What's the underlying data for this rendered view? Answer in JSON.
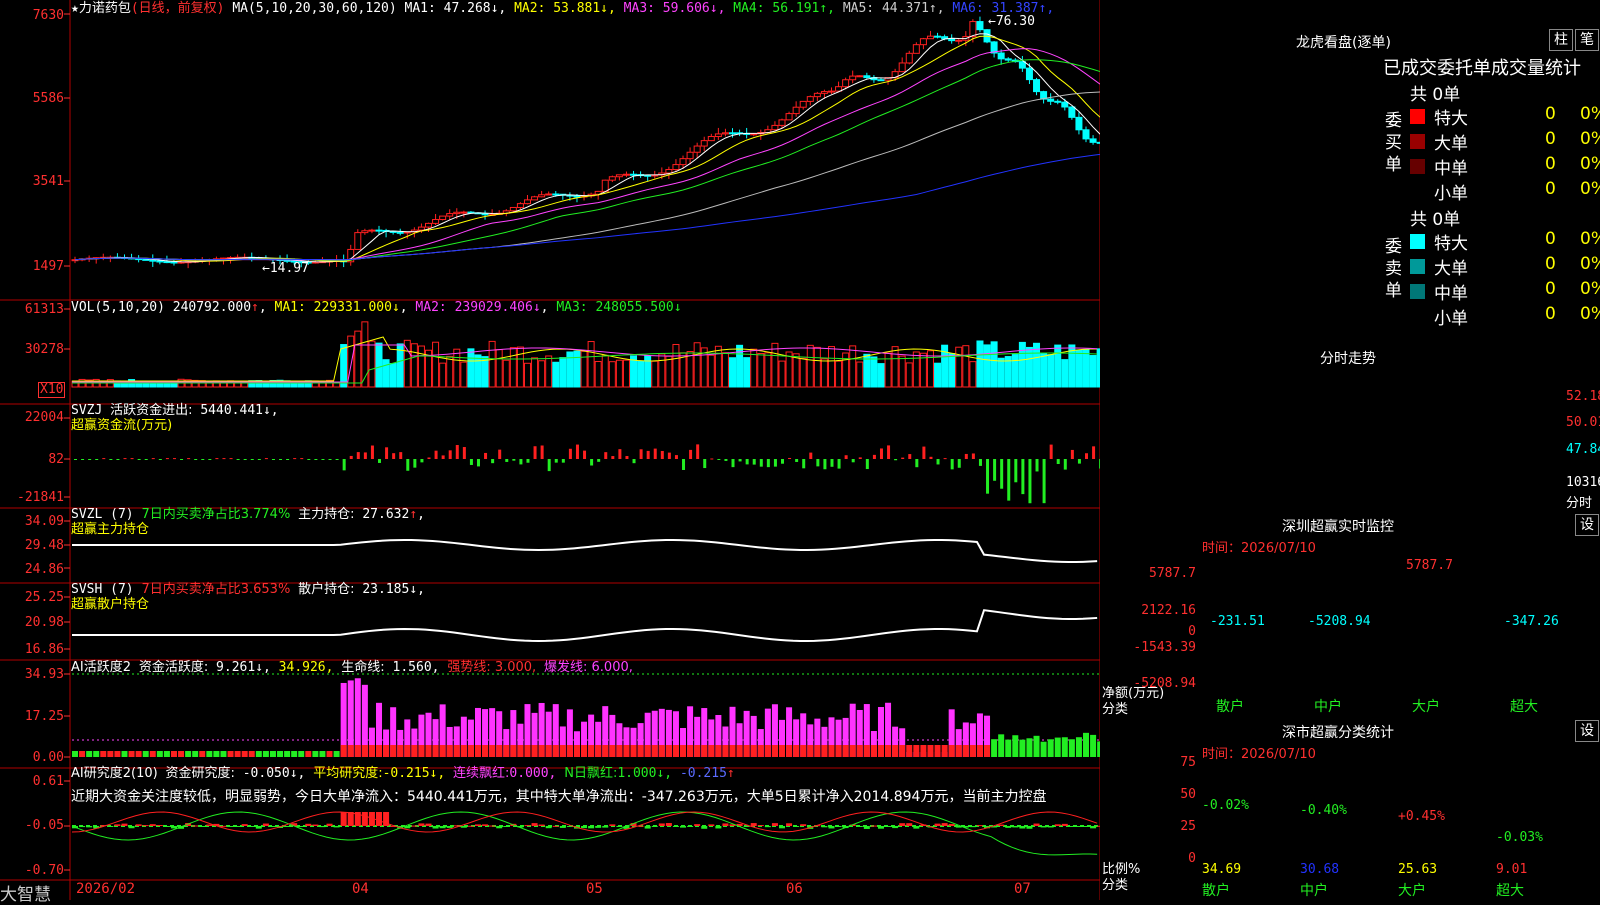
{
  "stock": {
    "name": "★力诺药包",
    "mode": "(日线，前复权)",
    "ma_title": "MA(5,10,20,30,60,120)",
    "ma": [
      {
        "label": "MA1:",
        "value": "47.268",
        "arrow": "↓",
        "color": "#ffffff"
      },
      {
        "label": "MA2:",
        "value": "53.881",
        "arrow": "↓",
        "color": "#ffff00"
      },
      {
        "label": "MA3:",
        "value": "59.606",
        "arrow": "↓",
        "color": "#ff44ff"
      },
      {
        "label": "MA4:",
        "value": "56.191",
        "arrow": "↑",
        "color": "#22ee22"
      },
      {
        "label": "MA5:",
        "value": "44.371",
        "arrow": "↑",
        "color": "#cccccc"
      },
      {
        "label": "MA6:",
        "value": "31.387",
        "arrow": "↑",
        "color": "#3344ff"
      }
    ],
    "price_axis": [
      "7630",
      "5586",
      "3541",
      "1497"
    ],
    "high_label": "76.30",
    "low_label": "14.97",
    "colors": {
      "up": "#ff2020",
      "down": "#00ffff",
      "ma1": "#ffffff",
      "ma2": "#ffff00",
      "ma3": "#ff44ff",
      "ma4": "#22ee22",
      "ma5": "#bbbbbb",
      "ma6": "#2233ff"
    }
  },
  "vol": {
    "title": "VOL(5,10,20)",
    "value": "240792.000",
    "ma1": "229331.000",
    "ma2": "239029.406",
    "ma3": "248055.500",
    "axis": [
      "61313",
      "30278"
    ],
    "unit": "X10"
  },
  "svzj": {
    "title": "SVZJ",
    "label": "活跃资金进出:",
    "value": "5440.441",
    "subtitle": "超赢资金流(万元)",
    "axis": [
      "22004",
      "82",
      "-21841"
    ]
  },
  "svzl": {
    "title": "SVZL (7)",
    "label": "7日内买卖净占比3.774%",
    "label2": "主力持仓:",
    "value": "27.632",
    "subtitle": "超赢主力持仓",
    "axis": [
      "34.09",
      "29.48",
      "24.86"
    ]
  },
  "svsh": {
    "title": "SVSH (7)",
    "label": "7日内买卖净占比3.653%",
    "label2": "散户持仓:",
    "value": "23.185",
    "subtitle": "超赢散户持仓",
    "axis": [
      "25.25",
      "20.98",
      "16.86"
    ]
  },
  "ai1": {
    "title": "AI活跃度2",
    "label": "资金活跃度:",
    "value": "9.261",
    "v2": "34.926",
    "life_label": "生命线:",
    "life": "1.560",
    "strong": "强势线: 3.000,",
    "burst": "爆发线: 6.000,",
    "axis": [
      "34.93",
      "17.25",
      "0.00"
    ]
  },
  "ai2": {
    "title": "AI研究度2(10)",
    "label": "资金研究度:",
    "value": "-0.050",
    "avg_label": "平均研究度:",
    "avg": "-0.215",
    "red_label": "连续飘红:",
    "red": "0.000,",
    "nred_label": "N日飘红:",
    "nred": "1.000",
    "last": "-0.215",
    "commentary": "近期大资金关注度较低，明显弱势，今日大单净流入：5440.441万元，其中特大单净流出：-347.263万元，大单5日累计净入2014.894万元，当前主力控盘",
    "axis": [
      "0.61",
      "-0.05",
      "-0.70"
    ]
  },
  "footer": {
    "brand": "大智慧",
    "dates": [
      "2026/02",
      "04",
      "05",
      "06",
      "07"
    ]
  },
  "lhb": {
    "title": "龙虎看盘(逐单)",
    "btn1": "柱",
    "btn2": "笔",
    "subtitle": "已成交委托单成交量统计",
    "buy_side": "委买单",
    "sell_side": "委卖单",
    "buy_total": "共 0单",
    "sell_total": "共 0单",
    "buy_rows": [
      {
        "label": "特大",
        "count": "0",
        "pct": "0%",
        "color": "#ff0000"
      },
      {
        "label": "大单",
        "count": "0",
        "pct": "0%",
        "color": "#990000"
      },
      {
        "label": "中单",
        "count": "0",
        "pct": "0%",
        "color": "#660000"
      },
      {
        "label": "小单",
        "count": "0",
        "pct": "0%",
        "color": ""
      }
    ],
    "sell_rows": [
      {
        "label": "特大",
        "count": "0",
        "pct": "0%",
        "color": "#00ffff"
      },
      {
        "label": "大单",
        "count": "0",
        "pct": "0%",
        "color": "#009999"
      },
      {
        "label": "中单",
        "count": "0",
        "pct": "0%",
        "color": "#007777"
      },
      {
        "label": "小单",
        "count": "0",
        "pct": "0%",
        "color": ""
      }
    ]
  },
  "fenshi": {
    "title": "分时走势",
    "axis": [
      "52.18",
      "50.01",
      "47.84",
      "10316"
    ],
    "unit": "分时"
  },
  "sz_monitor": {
    "title": "深圳超赢实时监控",
    "btn": "设",
    "time_label": "时间：2026/07/10",
    "axis": [
      "5787.7",
      "2122.16",
      "0",
      "-1543.39",
      "-5208.94"
    ],
    "ylab1": "净额(万元)",
    "ylab2": "分类",
    "bars": [
      {
        "cat": "散户",
        "value": "-231.51",
        "num": -231.51
      },
      {
        "cat": "中户",
        "value": "-5208.94",
        "num": -5208.94
      },
      {
        "cat": "大户",
        "value": "5787.7",
        "num": 5787.7
      },
      {
        "cat": "超大",
        "value": "-347.26",
        "num": -347.26
      }
    ]
  },
  "sz_class": {
    "title": "深市超赢分类统计",
    "btn": "设",
    "time_label": "时间：2026/07/10",
    "axis": [
      "75",
      "50",
      "25",
      "0"
    ],
    "ylab1": "比例%",
    "ylab2": "分类",
    "bars": [
      {
        "cat": "散户",
        "value": "34.69",
        "num": 34.69,
        "change": "-0.02%",
        "color": "#22ee22"
      },
      {
        "cat": "中户",
        "value": "30.68",
        "num": 30.68,
        "change": "-0.40%",
        "color": "#22ee22"
      },
      {
        "cat": "大户",
        "value": "25.63",
        "num": 25.63,
        "change": "+0.45%",
        "color": "#ff3030"
      },
      {
        "cat": "超大",
        "value": "9.01",
        "num": 9.01,
        "change": "-0.03%",
        "color": "#22ee22"
      }
    ]
  }
}
